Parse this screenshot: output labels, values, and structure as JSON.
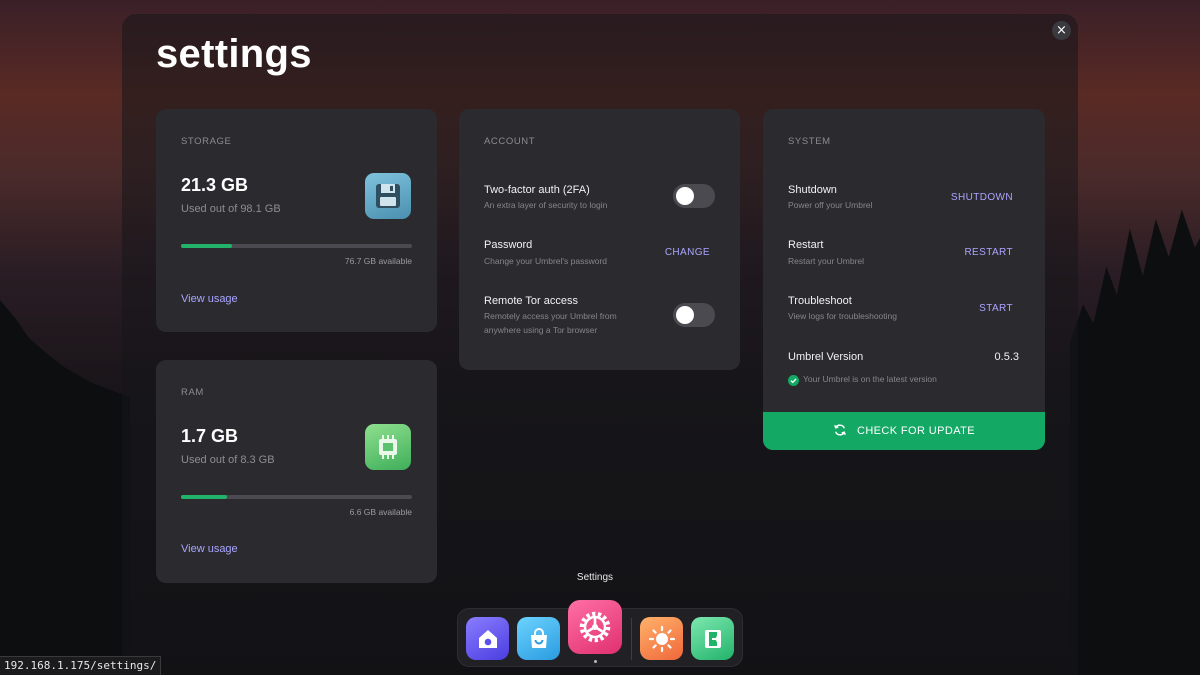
{
  "page": {
    "title": "settings",
    "close_symbol": "×"
  },
  "storage": {
    "label": "STORAGE",
    "value": "21.3 GB",
    "sub": "Used out of 98.1 GB",
    "available": "76.7 GB available",
    "used_fraction": 0.22,
    "link": "View usage",
    "icon": "floppy-disk-icon"
  },
  "ram": {
    "label": "RAM",
    "value": "1.7 GB",
    "sub": "Used out of 8.3 GB",
    "available": "6.6 GB available",
    "used_fraction": 0.2,
    "link": "View usage",
    "icon": "memory-chip-icon"
  },
  "account": {
    "label": "ACCOUNT",
    "rows": [
      {
        "title": "Two-factor auth (2FA)",
        "sub": "An extra layer of security to login",
        "control": "toggle",
        "enabled": false
      },
      {
        "title": "Password",
        "sub": "Change your Umbrel's password",
        "action": "CHANGE"
      },
      {
        "title": "Remote Tor access",
        "sub": "Remotely access your Umbrel from anywhere using a Tor browser",
        "control": "toggle",
        "enabled": false
      }
    ]
  },
  "system": {
    "label": "SYSTEM",
    "rows": [
      {
        "title": "Shutdown",
        "sub": "Power off your Umbrel",
        "action": "SHUTDOWN"
      },
      {
        "title": "Restart",
        "sub": "Restart your Umbrel",
        "action": "RESTART"
      },
      {
        "title": "Troubleshoot",
        "sub": "View logs for troubleshooting",
        "action": "START"
      }
    ],
    "version_label": "Umbrel Version",
    "version": "0.5.3",
    "version_status": "Your Umbrel is on the latest version",
    "update_button": "CHECK FOR UPDATE"
  },
  "dock": {
    "tooltip": "Settings",
    "items": [
      {
        "name": "home",
        "icon": "home-icon"
      },
      {
        "name": "app-store",
        "icon": "shopping-bag-icon"
      },
      {
        "name": "settings",
        "icon": "gear-icon",
        "active": true
      },
      {
        "name": "live-usage",
        "icon": "sun-icon"
      },
      {
        "name": "widgets",
        "icon": "exit-door-icon"
      }
    ]
  },
  "status_bar": {
    "url": "192.168.1.175/settings/"
  },
  "colors": {
    "accent": "#a9a4ff",
    "success": "#14a865",
    "card": "#2b2b2f"
  }
}
